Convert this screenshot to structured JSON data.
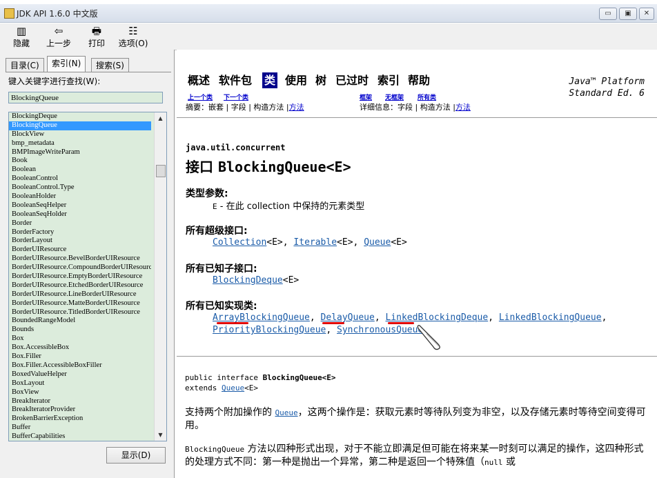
{
  "window": {
    "title": "JDK API 1.6.0 中文版",
    "min": "▭",
    "max": "▣",
    "close": "✕"
  },
  "toolbar": {
    "hide": "隐藏",
    "back": "上一步",
    "print": "打印",
    "options": "选项(O)"
  },
  "left": {
    "tabs": [
      "目录(C)",
      "索引(N)",
      "搜索(S)"
    ],
    "keyword_label": "键入关键字进行查找(W):",
    "keyword_value": "BlockingQueue",
    "items": [
      "BlockingDeque",
      "BlockingQueue",
      "BlockView",
      "bmp_metadata",
      "BMPImageWriteParam",
      "Book",
      "Boolean",
      "BooleanControl",
      "BooleanControl.Type",
      "BooleanHolder",
      "BooleanSeqHelper",
      "BooleanSeqHolder",
      "Border",
      "BorderFactory",
      "BorderLayout",
      "BorderUIResource",
      "BorderUIResource.BevelBorderUIResource",
      "BorderUIResource.CompoundBorderUIResource",
      "BorderUIResource.EmptyBorderUIResource",
      "BorderUIResource.EtchedBorderUIResource",
      "BorderUIResource.LineBorderUIResource",
      "BorderUIResource.MatteBorderUIResource",
      "BorderUIResource.TitledBorderUIResource",
      "BoundedRangeModel",
      "Bounds",
      "Box",
      "Box.AccessibleBox",
      "Box.Filler",
      "Box.Filler.AccessibleBoxFiller",
      "BoxedValueHelper",
      "BoxLayout",
      "BoxView",
      "BreakIterator",
      "BreakIteratorProvider",
      "BrokenBarrierException",
      "Buffer",
      "BufferCapabilities"
    ],
    "selected_index": 1,
    "show_button": "显示(D)"
  },
  "doc": {
    "nav": [
      "概述",
      "软件包",
      "类",
      "使用",
      "树",
      "已过时",
      "索引",
      "帮助"
    ],
    "platform_1": "Java™ Platform",
    "platform_2": "Standard Ed. 6",
    "prev_class": "上一个类",
    "next_class": "下一个类",
    "frames": "框架",
    "no_frames": "无框架",
    "all_classes": "所有类",
    "summary_label": "摘要：",
    "summary_items": "嵌套 | 字段 | 构造方法 |",
    "summary_method": "方法",
    "detail_label": "详细信息：",
    "detail_items": "字段 | 构造方法 |",
    "detail_method": "方法",
    "package": "java.util.concurrent",
    "title_prefix": "接口",
    "title_name": "BlockingQueue<E>",
    "type_params_head": "类型参数:",
    "type_param_name": "E",
    "type_param_desc": " - 在此 collection 中保持的元素类型",
    "super_head": "所有超级接口:",
    "super_1": "Collection",
    "super_2": "Iterable",
    "super_3": "Queue",
    "generic": "<E>",
    "sub_head": "所有已知子接口:",
    "sub_1": "BlockingDeque",
    "impl_head": "所有已知实现类:",
    "impl": [
      "ArrayBlockingQueue",
      "DelayQueue",
      "LinkedBlockingDeque",
      "LinkedBlockingQueue",
      "PriorityBlockingQueue",
      "SynchronousQueue"
    ],
    "decl_1_prefix": "public interface ",
    "decl_1_name": "BlockingQueue<E>",
    "decl_2_prefix": "extends ",
    "decl_2_link": "Queue",
    "para1_a": "支持两个附加操作的 ",
    "para1_link": "Queue",
    "para1_b": "，这两个操作是：获取元素时等待队列变为非空，以及存储元素时等待空间变得可用。",
    "para2_code": "BlockingQueue",
    "para2_a": " 方法以四种形式出现，对于不能立即满足但可能在将来某一时刻可以满足的操作，这四种形式的处理方式不同：第一种是抛出一个异常，第二种是返回一个特殊值（",
    "para2_null": "null",
    "para2_b": " 或"
  }
}
